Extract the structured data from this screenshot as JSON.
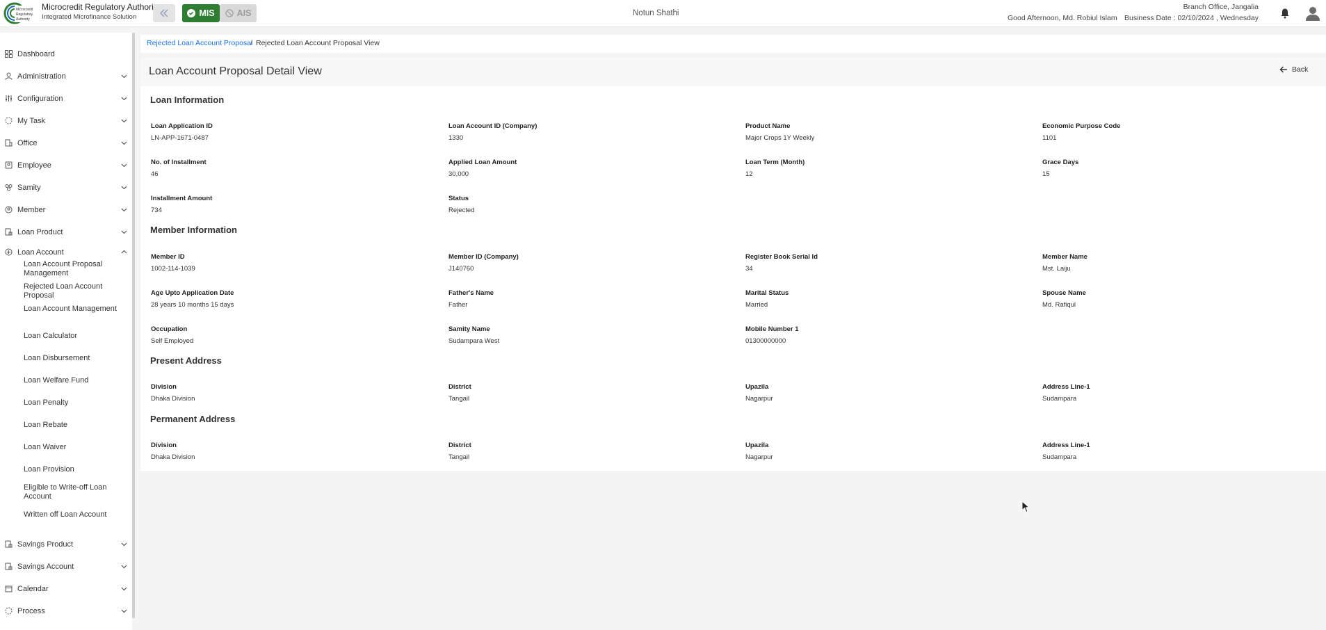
{
  "header": {
    "brand_title": "Microcredit Regulatory Authority",
    "brand_sub": "Integrated Microfinance Solution",
    "logo_text": "Microcredit Regulatory Authority",
    "mis_label": "MIS",
    "ais_label": "AIS",
    "org_name": "Notun Shathi",
    "branch": "Branch Office, Jangalia",
    "greeting": "Good Afternoon, Md. Robiul Islam",
    "business_date": "Business Date : 02/10/2024 , Wednesday",
    "collapse_icon": "double-chevron-left-icon",
    "bell_icon": "bell-icon",
    "avatar_icon": "user-avatar-icon",
    "accent": "#2e7d32"
  },
  "sidebar": {
    "items": [
      {
        "label": "Dashboard",
        "icon": "dashboard-icon"
      },
      {
        "label": "Administration",
        "icon": "admin-icon"
      },
      {
        "label": "Configuration",
        "icon": "sliders-icon"
      },
      {
        "label": "My Task",
        "icon": "task-icon"
      },
      {
        "label": "Office",
        "icon": "office-icon"
      },
      {
        "label": "Employee",
        "icon": "employee-icon"
      },
      {
        "label": "Samity",
        "icon": "group-icon"
      },
      {
        "label": "Member",
        "icon": "member-icon"
      },
      {
        "label": "Loan Product",
        "icon": "loan-product-icon"
      },
      {
        "label": "Loan Account",
        "icon": "loan-account-icon"
      },
      {
        "label": "Savings Product",
        "icon": "savings-product-icon"
      },
      {
        "label": "Savings Account",
        "icon": "savings-account-icon"
      },
      {
        "label": "Calendar",
        "icon": "calendar-icon"
      },
      {
        "label": "Process",
        "icon": "process-icon"
      }
    ],
    "loan_account_sub": [
      "Loan Account Proposal Management",
      "Rejected Loan Account Proposal",
      "Loan Account Management",
      "Loan Calculator",
      "Loan Disbursement",
      "Loan Welfare Fund",
      "Loan Penalty",
      "Loan Rebate",
      "Loan Waiver",
      "Loan Provision",
      "Eligible to Write-off Loan Account",
      "Written off Loan Account"
    ]
  },
  "breadcrumb": {
    "link": "Rejected Loan Account Proposal",
    "separator": "/",
    "current": "Rejected Loan Account Proposal View"
  },
  "page": {
    "title": "Loan Account Proposal Detail View",
    "back_label": "Back"
  },
  "sections": {
    "loan_info": {
      "title": "Loan Information",
      "fields": [
        {
          "label": "Loan Application ID",
          "value": "LN-APP-1671-0487"
        },
        {
          "label": "Loan Account ID (Company)",
          "value": "1330"
        },
        {
          "label": "Product Name",
          "value": "Major Crops 1Y Weekly"
        },
        {
          "label": "Economic Purpose Code",
          "value": "1101"
        },
        {
          "label": "No. of Installment",
          "value": "46"
        },
        {
          "label": "Applied Loan Amount",
          "value": "30,000"
        },
        {
          "label": "Loan Term (Month)",
          "value": "12"
        },
        {
          "label": "Grace Days",
          "value": "15"
        },
        {
          "label": "Installment Amount",
          "value": "734"
        },
        {
          "label": "Status",
          "value": "Rejected"
        }
      ]
    },
    "member_info": {
      "title": "Member Information",
      "fields": [
        {
          "label": "Member ID",
          "value": "1002-114-1039"
        },
        {
          "label": "Member ID (Company)",
          "value": "J140760"
        },
        {
          "label": "Register Book Serial Id",
          "value": "34"
        },
        {
          "label": "Member Name",
          "value": "Mst. Laiju"
        },
        {
          "label": "Age Upto Application Date",
          "value": "28 years 10 months 15 days"
        },
        {
          "label": "Father's Name",
          "value": "Father"
        },
        {
          "label": "Marital Status",
          "value": "Married"
        },
        {
          "label": "Spouse Name",
          "value": "Md. Rafiqul"
        },
        {
          "label": "Occupation",
          "value": "Self Employed"
        },
        {
          "label": "Samity Name",
          "value": "Sudampara West"
        },
        {
          "label": "Mobile Number 1",
          "value": "01300000000"
        }
      ]
    },
    "present_address": {
      "title": "Present Address",
      "fields": [
        {
          "label": "Division",
          "value": "Dhaka Division"
        },
        {
          "label": "District",
          "value": "Tangail"
        },
        {
          "label": "Upazila",
          "value": "Nagarpur"
        },
        {
          "label": "Address Line-1",
          "value": "Sudampara"
        }
      ]
    },
    "permanent_address": {
      "title": "Permanent Address",
      "fields": [
        {
          "label": "Division",
          "value": "Dhaka Division"
        },
        {
          "label": "District",
          "value": "Tangail"
        },
        {
          "label": "Upazila",
          "value": "Nagarpur"
        },
        {
          "label": "Address Line-1",
          "value": "Sudampara"
        }
      ]
    }
  }
}
